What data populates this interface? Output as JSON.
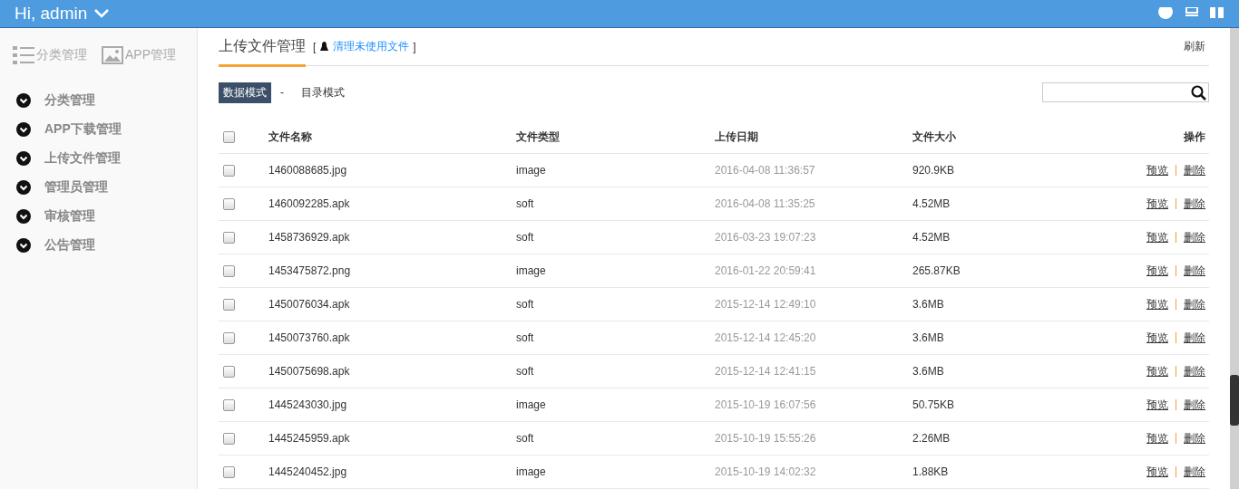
{
  "header": {
    "greeting": "Hi, admin"
  },
  "sidebar": {
    "tabs": [
      {
        "label": "分类管理",
        "kind": "list",
        "selected": false
      },
      {
        "label": "APP管理",
        "kind": "image",
        "selected": false
      }
    ],
    "items": [
      {
        "label": "分类管理",
        "expanded": false
      },
      {
        "label": "APP下载管理",
        "expanded": false
      },
      {
        "label": "上传文件管理",
        "expanded": false
      },
      {
        "label": "管理员管理",
        "expanded": false
      },
      {
        "label": "审核管理",
        "expanded": false
      },
      {
        "label": "公告管理",
        "expanded": false
      }
    ]
  },
  "main": {
    "title": "上传文件管理",
    "bracket_open": "[",
    "clean_link": "清理未使用文件",
    "bracket_close": "]",
    "refresh": "刷新",
    "modes": [
      {
        "label": "数据模式",
        "selected": true
      },
      {
        "label": "目录模式",
        "selected": false
      }
    ],
    "mode_separator": "-",
    "table": {
      "columns": [
        "文件名称",
        "文件类型",
        "上传日期",
        "文件大小",
        "操作"
      ],
      "select_all": false,
      "rows": [
        {
          "name": "1460088685.jpg",
          "type": "image",
          "date": "2016-04-08 11:36:57",
          "size": "920.9KB",
          "checked": false,
          "actions": [
            "预览",
            "删除"
          ]
        },
        {
          "name": "1460092285.apk",
          "type": "soft",
          "date": "2016-04-08 11:35:25",
          "size": "4.52MB",
          "checked": false,
          "actions": [
            "预览",
            "删除"
          ]
        },
        {
          "name": "1458736929.apk",
          "type": "soft",
          "date": "2016-03-23 19:07:23",
          "size": "4.52MB",
          "checked": false,
          "actions": [
            "预览",
            "删除"
          ]
        },
        {
          "name": "1453475872.png",
          "type": "image",
          "date": "2016-01-22 20:59:41",
          "size": "265.87KB",
          "checked": false,
          "actions": [
            "预览",
            "删除"
          ]
        },
        {
          "name": "1450076034.apk",
          "type": "soft",
          "date": "2015-12-14 12:49:10",
          "size": "3.6MB",
          "checked": false,
          "actions": [
            "预览",
            "删除"
          ]
        },
        {
          "name": "1450073760.apk",
          "type": "soft",
          "date": "2015-12-14 12:45:20",
          "size": "3.6MB",
          "checked": false,
          "actions": [
            "预览",
            "删除"
          ]
        },
        {
          "name": "1450075698.apk",
          "type": "soft",
          "date": "2015-12-14 12:41:15",
          "size": "3.6MB",
          "checked": false,
          "actions": [
            "预览",
            "删除"
          ]
        },
        {
          "name": "1445243030.jpg",
          "type": "image",
          "date": "2015-10-19 16:07:56",
          "size": "50.75KB",
          "checked": false,
          "actions": [
            "预览",
            "删除"
          ]
        },
        {
          "name": "1445245959.apk",
          "type": "soft",
          "date": "2015-10-19 15:55:26",
          "size": "2.26MB",
          "checked": false,
          "actions": [
            "预览",
            "删除"
          ]
        },
        {
          "name": "1445240452.jpg",
          "type": "image",
          "date": "2015-10-19 14:02:32",
          "size": "1.88KB",
          "checked": false,
          "actions": [
            "预览",
            "删除"
          ]
        }
      ]
    }
  }
}
